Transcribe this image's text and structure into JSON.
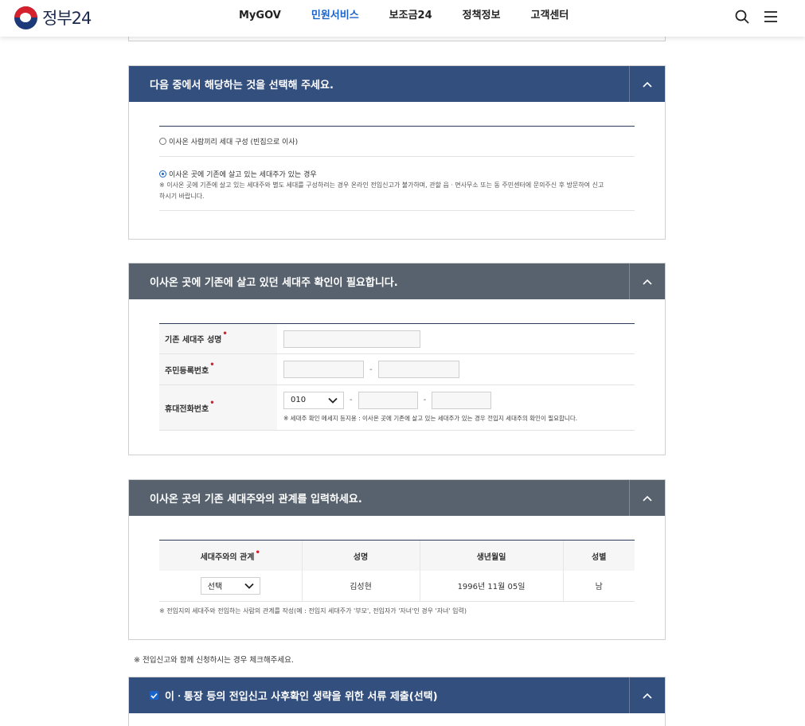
{
  "header": {
    "logo_text": "정부24",
    "nav": [
      "MyGOV",
      "민원서비스",
      "보조금24",
      "정책정보",
      "고객센터"
    ],
    "active_nav": "민원서비스"
  },
  "section1": {
    "title": "다음 중에서 해당하는 것을 선택해 주세요.",
    "option1": "이사온 사람끼리 세대 구성 (빈집으로 이사)",
    "option2": "이사온 곳에 기존에 살고 있는 세대주가 있는 경우",
    "note_line1": "※ 이사온 곳에 기존에 살고 있는 세대주와 별도 세대를 구성하려는 경우 온라인 전입신고가 불가하며, 관할 읍ㆍ면사무소 또는 동 주민센터에 문의주신 후 방문하여 신고",
    "note_line2": "하시기 바랍니다."
  },
  "section2": {
    "title": "이사온 곳에 기존에 살고 있던 세대주 확인이 필요합니다.",
    "label_name": "기존 세대주 성명",
    "label_rrn": "주민등록번호",
    "label_phone": "휴대전화번호",
    "phone_prefix": "010",
    "phone_note": "※ 세대주 확인 메세지 등지용 : 이사온 곳에 기존에 살고 있는 세대주가 있는 경우 전입지 세대주의 확인이 필요합니다."
  },
  "section3": {
    "title": "이사온 곳의 기존 세대주와의 관계를 입력하세요.",
    "headers": [
      "세대주와의 관계",
      "성명",
      "생년월일",
      "성별"
    ],
    "row": {
      "relation": "선택",
      "name": "김성현",
      "birth": "1996년 11월 05일",
      "gender": "남"
    },
    "note": "※ 전입지의 세대주와 전입하는 사람의 관계를 작성(예 : 전입지 세대주가 '부모', 전입자가 '자녀'인 경우 '자녀' 입력)"
  },
  "notice": "※ 전입신고와 함께 신청하시는 경우 체크해주세요.",
  "section4": {
    "title": "이ㆍ통장 등의 전입신고 사후확인 생략을 위한 서류 제출(선택)",
    "checked": true
  },
  "colors": {
    "navy": "#334f7e",
    "slate": "#57626e",
    "accent": "#1a63c9",
    "required": "#d5202e"
  },
  "icons": [
    "search-icon",
    "menu-icon",
    "chevron-up-icon",
    "chevron-down-icon",
    "check-icon"
  ]
}
